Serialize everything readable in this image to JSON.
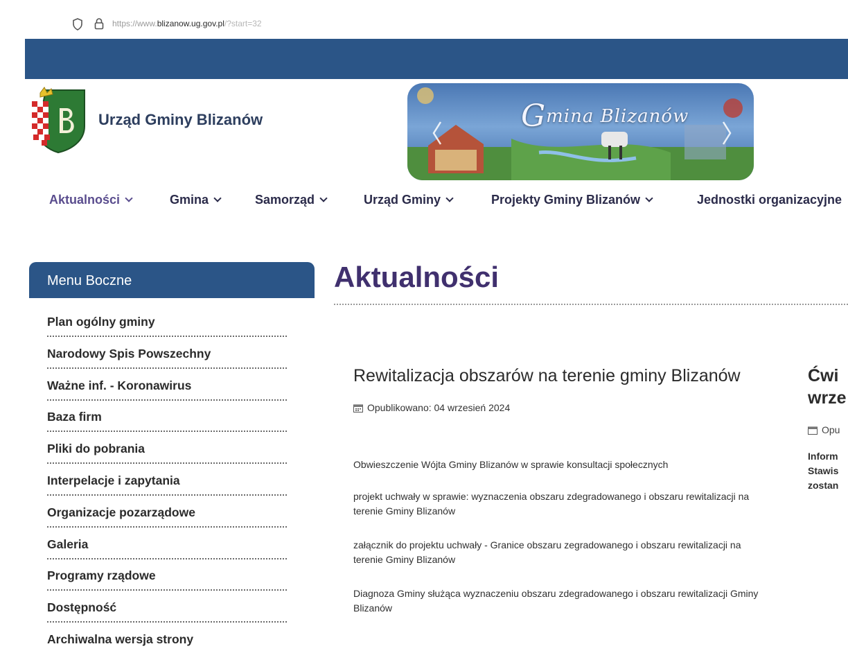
{
  "browser": {
    "url_prefix": "https://www.",
    "url_domain": "blizanow.ug.gov.pl",
    "url_suffix": "/?start=32"
  },
  "header": {
    "site_title": "Urząd Gminy Blizanów",
    "banner_text_initial": "G",
    "banner_text_rest": "mina Blizanów"
  },
  "nav": {
    "items": [
      {
        "label": "Aktualności",
        "active": true
      },
      {
        "label": "Gmina"
      },
      {
        "label": "Samorząd"
      },
      {
        "label": "Urząd Gminy"
      },
      {
        "label": "Projekty Gminy Blizanów"
      },
      {
        "label": "Jednostki organizacyjne"
      }
    ]
  },
  "sidebar": {
    "heading": "Menu Boczne",
    "items": [
      {
        "label": "Plan ogólny gminy"
      },
      {
        "label": "Narodowy Spis Powszechny"
      },
      {
        "label": "Ważne inf. - Koronawirus"
      },
      {
        "label": "Baza firm"
      },
      {
        "label": "Pliki do pobrania"
      },
      {
        "label": "Interpelacje i zapytania"
      },
      {
        "label": "Organizacje pozarządowe"
      },
      {
        "label": "Galeria"
      },
      {
        "label": "Programy rządowe"
      },
      {
        "label": "Dostępność"
      },
      {
        "label": "Archiwalna wersja strony"
      }
    ]
  },
  "main": {
    "page_title": "Aktualności",
    "article": {
      "title": "Rewitalizacja obszarów na terenie gminy Blizanów",
      "published": "Opublikowano: 04 wrzesień 2024",
      "paragraphs": [
        "Obwieszczenie Wójta Gminy Blizanów w sprawie konsultacji społecznych",
        " projekt uchwały w sprawie: wyznaczenia obszaru zdegradowanego i obszaru rewitalizacji na terenie Gminy Blizanów",
        "załącznik do projektu uchwały - Granice obszaru zegradowanego i obszaru rewitalizacji na terenie Gminy Blizanów",
        " Diagnoza Gminy służąca wyznaczeniu obszaru zdegradowanego i obszaru rewitalizacji Gminy Blizanów"
      ]
    },
    "article2": {
      "title_line1": "Ćwi",
      "title_line2": "wrze",
      "meta": "Opu",
      "body_line1": "Inform",
      "body_line2": "Stawis",
      "body_line3": "zostan"
    }
  },
  "colors": {
    "brand_blue": "#2b5587",
    "title_purple": "#40306e",
    "nav_active": "#5a4d8e"
  }
}
